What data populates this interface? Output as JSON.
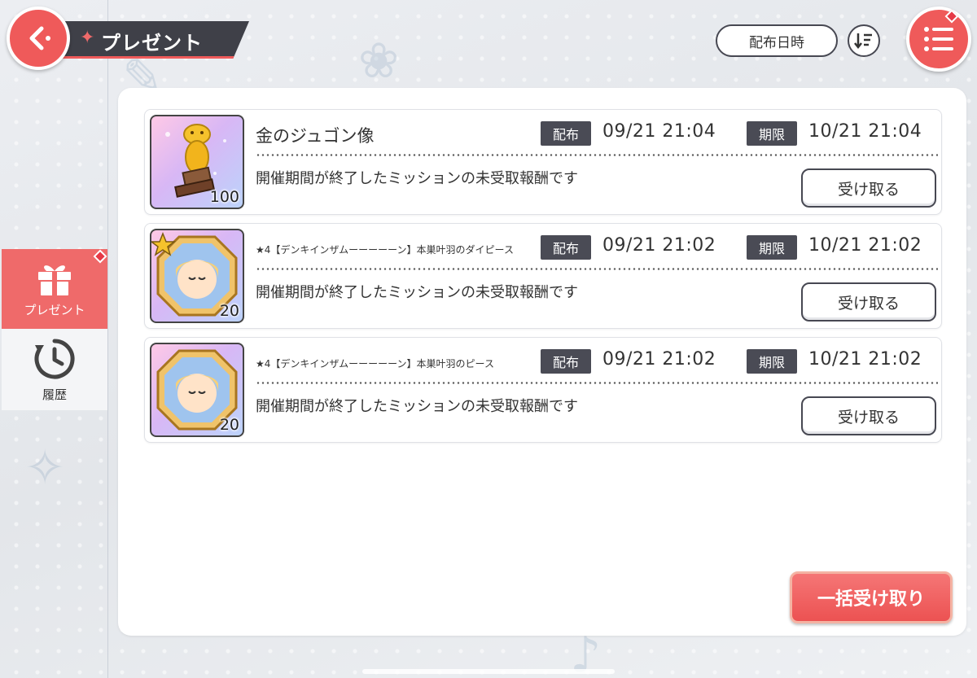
{
  "header": {
    "title": "プレゼント",
    "sort_label": "配布日時"
  },
  "sidebar": {
    "items": [
      {
        "label": "プレゼント",
        "icon": "gift-icon",
        "active": true
      },
      {
        "label": "履歴",
        "icon": "history-icon",
        "active": false
      }
    ]
  },
  "presents": [
    {
      "name": "金のジュゴン像",
      "quantity": "100",
      "dist_tag": "配布",
      "dist_date": "09/21 21:04",
      "limit_tag": "期限",
      "limit_date": "10/21 21:04",
      "description": "開催期間が終了したミッションの未受取報酬です",
      "button": "受け取る",
      "icon": "golden-trophy-icon"
    },
    {
      "name": "★4【デンキインザムーーーーーン】本巣叶羽のダイピース",
      "quantity": "20",
      "dist_tag": "配布",
      "dist_date": "09/21 21:02",
      "limit_tag": "期限",
      "limit_date": "10/21 21:02",
      "description": "開催期間が終了したミッションの未受取報酬です",
      "button": "受け取る",
      "icon": "character-die-piece-icon"
    },
    {
      "name": "★4【デンキインザムーーーーーン】本巣叶羽のピース",
      "quantity": "20",
      "dist_tag": "配布",
      "dist_date": "09/21 21:02",
      "limit_tag": "期限",
      "limit_date": "10/21 21:02",
      "description": "開催期間が終了したミッションの未受取報酬です",
      "button": "受け取る",
      "icon": "character-piece-icon"
    }
  ],
  "footer": {
    "receive_all": "一括受け取り"
  },
  "colors": {
    "accent": "#ef5a5a",
    "dark": "#4a4b55",
    "panel": "#ffffff"
  }
}
